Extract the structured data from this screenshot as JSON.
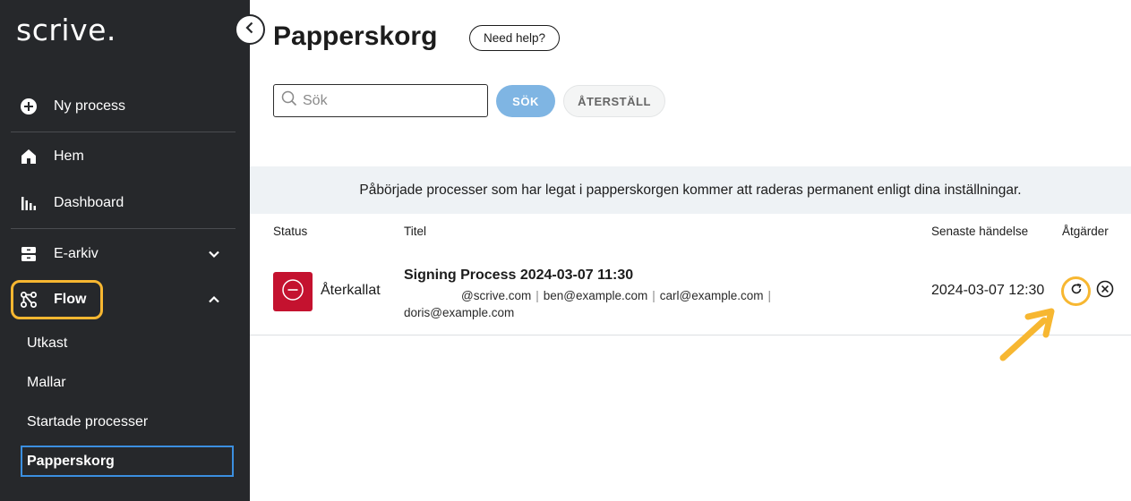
{
  "brand": {
    "logo_text": "scrive."
  },
  "sidebar": {
    "new_process": "Ny process",
    "items": [
      {
        "label": "Hem",
        "icon": "home-icon"
      },
      {
        "label": "Dashboard",
        "icon": "dashboard-icon"
      },
      {
        "label": "E-arkiv",
        "icon": "archive-icon"
      },
      {
        "label": "Flow",
        "icon": "flow-icon"
      }
    ],
    "flow_sub": [
      "Utkast",
      "Mallar",
      "Startade processer"
    ],
    "active_sub": "Papperskorg"
  },
  "header": {
    "title": "Papperskorg",
    "help_label": "Need help?"
  },
  "search": {
    "placeholder": "Sök",
    "value": "",
    "search_label": "SÖK",
    "reset_label": "ÅTERSTÄLL"
  },
  "info_message": "Påbörjade processer som har legat i papperskorgen kommer att raderas permanent enligt dina inställningar.",
  "table": {
    "headers": {
      "status": "Status",
      "title": "Titel",
      "last_event": "Senaste händelse",
      "actions": "Åtgärder"
    },
    "rows": [
      {
        "status": "Återkallat",
        "title": "Signing Process 2024-03-07 11:30",
        "parties": [
          "@scrive.com",
          "ben@example.com",
          "carl@example.com",
          "doris@example.com"
        ],
        "last_event": "2024-03-07 12:30"
      }
    ]
  },
  "colors": {
    "sidebar_bg": "#26282b",
    "highlight": "#f7b731",
    "status_red": "#c4122f",
    "search_btn": "#7fb5e3",
    "active_border": "#3b8fe0"
  }
}
